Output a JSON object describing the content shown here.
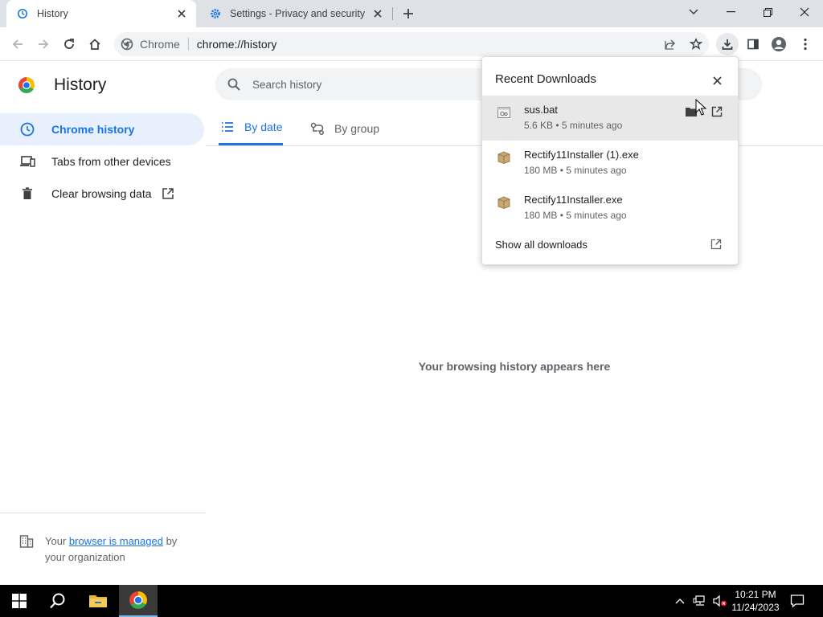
{
  "tabs": [
    {
      "title": "History",
      "icon": "history-icon",
      "active": true
    },
    {
      "title": "Settings - Privacy and security",
      "icon": "settings-gear-icon",
      "active": false
    }
  ],
  "toolbar": {
    "site_label": "Chrome",
    "url": "chrome://history"
  },
  "sidebar": {
    "title": "History",
    "items": [
      {
        "label": "Chrome history",
        "icon": "clock-icon",
        "selected": true
      },
      {
        "label": "Tabs from other devices",
        "icon": "devices-icon",
        "selected": false
      },
      {
        "label": "Clear browsing data",
        "icon": "trash-icon",
        "selected": false
      }
    ],
    "managed": {
      "prefix": "Your ",
      "link": "browser is managed",
      "suffix": " by your organization"
    }
  },
  "main": {
    "search_placeholder": "Search history",
    "view_tabs": [
      {
        "label": "By date",
        "active": true
      },
      {
        "label": "By group",
        "active": false
      }
    ],
    "empty_message": "Your browsing history appears here"
  },
  "downloads": {
    "title": "Recent Downloads",
    "items": [
      {
        "name": "sus.bat",
        "meta": "5.6 KB • 5 minutes ago"
      },
      {
        "name": "Rectify11Installer (1).exe",
        "meta": "180 MB • 5 minutes ago"
      },
      {
        "name": "Rectify11Installer.exe",
        "meta": "180 MB • 5 minutes ago"
      }
    ],
    "show_all": "Show all downloads"
  },
  "taskbar": {
    "time": "10:21 PM",
    "date": "11/24/2023"
  },
  "colors": {
    "accent": "#1a73e8",
    "tabstrip": "#dee1e6",
    "selected_nav": "#e8f0fe"
  }
}
